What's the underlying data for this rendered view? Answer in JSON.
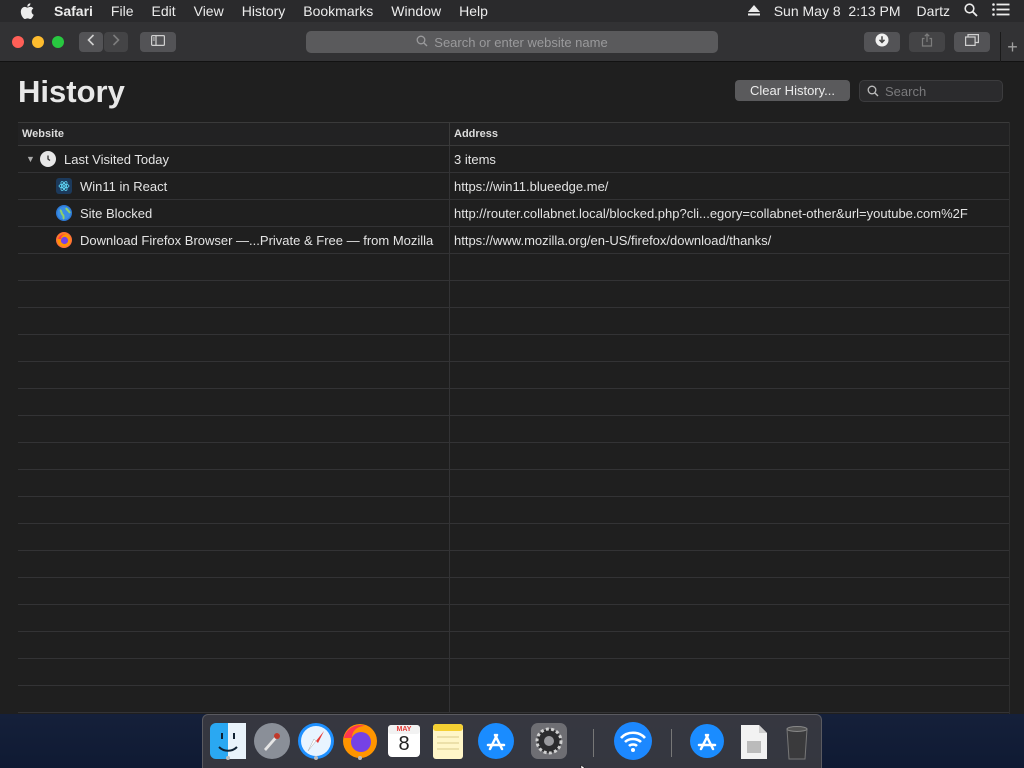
{
  "menubar": {
    "app_name": "Safari",
    "items": [
      "File",
      "Edit",
      "View",
      "History",
      "Bookmarks",
      "Window",
      "Help"
    ],
    "clock": "Sun May 8  2:13 PM",
    "user": "Dartz"
  },
  "toolbar": {
    "address_placeholder": "Search or enter website name"
  },
  "page": {
    "title": "History",
    "clear_button": "Clear History...",
    "search_placeholder": "Search"
  },
  "table": {
    "columns": [
      "Website",
      "Address"
    ],
    "group": {
      "label": "Last Visited Today",
      "count": "3 items"
    },
    "rows": [
      {
        "site": "Win11 in React",
        "address": "https://win11.blueedge.me/",
        "icon": "react-icon"
      },
      {
        "site": "Site Blocked",
        "address": "http://router.collabnet.local/blocked.php?cli...egory=collabnet-other&url=youtube.com%2F",
        "icon": "globe-icon"
      },
      {
        "site": "Download Firefox Browser —...Private & Free — from Mozilla",
        "address": "https://www.mozilla.org/en-US/firefox/download/thanks/",
        "icon": "firefox-icon"
      }
    ]
  },
  "dock": {
    "items": [
      "Finder",
      "Launchpad",
      "Safari",
      "Firefox",
      "Calendar",
      "Notes",
      "App Store",
      "System Preferences",
      "Wi-Fi",
      "App Store Downloads",
      "Disk Image",
      "Trash"
    ],
    "calendar_month": "MAY",
    "calendar_day": "8"
  }
}
